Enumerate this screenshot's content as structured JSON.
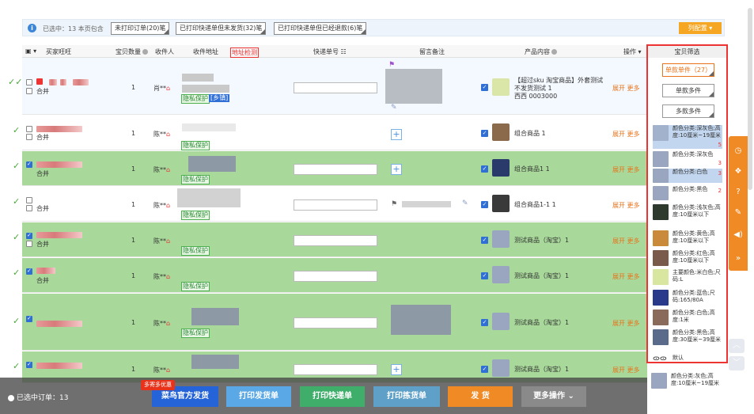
{
  "topbar": {
    "selected_info": "已选中：13 本页包含",
    "filters": [
      "未打印订单(20)笔",
      "已打印快递单但未发货(32)笔",
      "已打印快递单但已经退款(6)笔"
    ],
    "column_config": "列配置"
  },
  "table": {
    "headers": {
      "buyer": "买家旺旺",
      "qty": "宝贝数量",
      "receiver": "收件人",
      "address": "收件地址",
      "address_check": "地址检测",
      "tracking": "快递单号",
      "remark": "留言备注",
      "product": "产品内容",
      "ops": "操作"
    },
    "merge_label": "合并",
    "privacy_label": "隐私保护",
    "township_label": "[乡镇]",
    "ops_expand": "展开",
    "ops_more": "更多",
    "rows": [
      {
        "qty": "1",
        "receiver": "肖**",
        "product": [
          "【超过sku 淘宝商品】外套测试",
          "不发货测试 1",
          "西西 0003000"
        ]
      },
      {
        "qty": "1",
        "receiver": "陈**",
        "product": [
          "组合商品 1"
        ]
      },
      {
        "qty": "1",
        "receiver": "陈**",
        "product": [
          "组合商品1 1"
        ]
      },
      {
        "qty": "1",
        "receiver": "陈**",
        "product": [
          "组合商品1-1 1"
        ]
      },
      {
        "qty": "1",
        "receiver": "陈**",
        "product": [
          "测试商品（淘宝）1"
        ]
      },
      {
        "qty": "1",
        "receiver": "陈**",
        "product": [
          "测试商品（淘宝）1"
        ]
      },
      {
        "qty": "1",
        "receiver": "陈**",
        "product": [
          "测试商品（淘宝）1"
        ]
      },
      {
        "qty": "1",
        "receiver": "陈**",
        "product": [
          "测试商品（淘宝）1"
        ]
      }
    ]
  },
  "filter_panel": {
    "title": "宝贝筛选",
    "buttons": [
      "单款单件（27）",
      "单款多件",
      "多款多件"
    ],
    "items": [
      {
        "text": "颜色分类:深灰色;高度:10厘米~19厘米",
        "count": "5"
      },
      {
        "text": "颜色分类:深灰色",
        "count": "3"
      },
      {
        "text": "颜色分类:白色",
        "count": "3"
      },
      {
        "text": "颜色分类:黑色",
        "count": "2"
      },
      {
        "text": "颜色分类:浅灰色;高度:10厘米以下",
        "count": ""
      },
      {
        "text": "颜色分类:黄色;高度:10厘米以下",
        "count": ""
      },
      {
        "text": "颜色分类:红色;高度:10厘米以下",
        "count": ""
      },
      {
        "text": "主要颜色:米白色;尺码:L",
        "count": ""
      },
      {
        "text": "颜色分类:蓝色;尺码:165/80A",
        "count": ""
      },
      {
        "text": "颜色分类:白色;高度:1米",
        "count": ""
      },
      {
        "text": "颜色分类:黑色;高度:30厘米~39厘米",
        "count": ""
      },
      {
        "text": "默认",
        "count": ""
      },
      {
        "text": "颜色分类:灰色;高度:10厘米~19厘米",
        "count": ""
      }
    ]
  },
  "bottom": {
    "selected": "已选中订单：13",
    "promo": "多寄多优惠",
    "buttons": [
      "菜鸟官方发货",
      "打印发货单",
      "打印快递单",
      "打印拣货单",
      "发 货",
      "更多操作"
    ]
  },
  "colors": {
    "green_row": "#a8d99a",
    "accent_orange": "#f08a24",
    "blue": "#2f6fd6",
    "red": "#e33333"
  }
}
